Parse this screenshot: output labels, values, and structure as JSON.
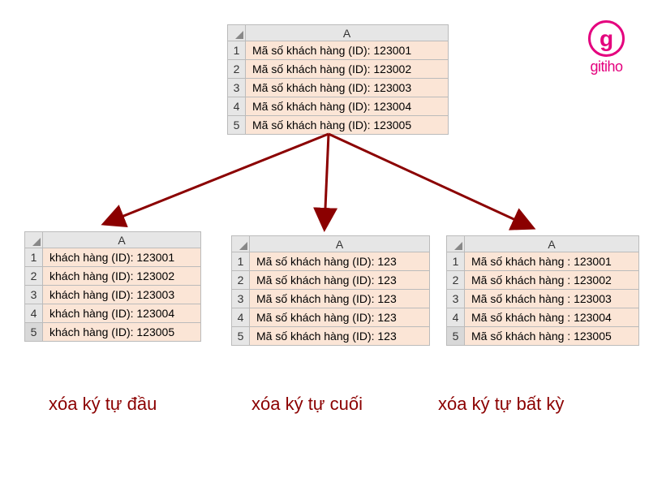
{
  "logo": {
    "glyph": "g",
    "name": "gitiho"
  },
  "top_table": {
    "col": "A",
    "rows": [
      "Mã số khách hàng (ID): 123001",
      "Mã số khách hàng (ID): 123002",
      "Mã số khách hàng (ID): 123003",
      "Mã số khách hàng (ID): 123004",
      "Mã số khách hàng (ID): 123005"
    ]
  },
  "table_a": {
    "col": "A",
    "rows": [
      "khách hàng (ID): 123001",
      "khách hàng (ID): 123002",
      "khách hàng (ID): 123003",
      "khách hàng (ID): 123004",
      "khách hàng (ID): 123005"
    ]
  },
  "table_b": {
    "col": "A",
    "rows": [
      "Mã số khách hàng (ID): 123",
      "Mã số khách hàng (ID): 123",
      "Mã số khách hàng (ID): 123",
      "Mã số khách hàng (ID): 123",
      "Mã số khách hàng (ID): 123"
    ]
  },
  "table_c": {
    "col": "A",
    "rows": [
      "Mã số khách hàng : 123001",
      "Mã số khách hàng : 123002",
      "Mã số khách hàng : 123003",
      "Mã số khách hàng : 123004",
      "Mã số khách hàng : 123005"
    ]
  },
  "captions": {
    "a": "xóa ký tự đầu",
    "b": "xóa ký tự cuối",
    "c": "xóa ký tự bất kỳ"
  },
  "rownums": [
    "1",
    "2",
    "3",
    "4",
    "5"
  ]
}
